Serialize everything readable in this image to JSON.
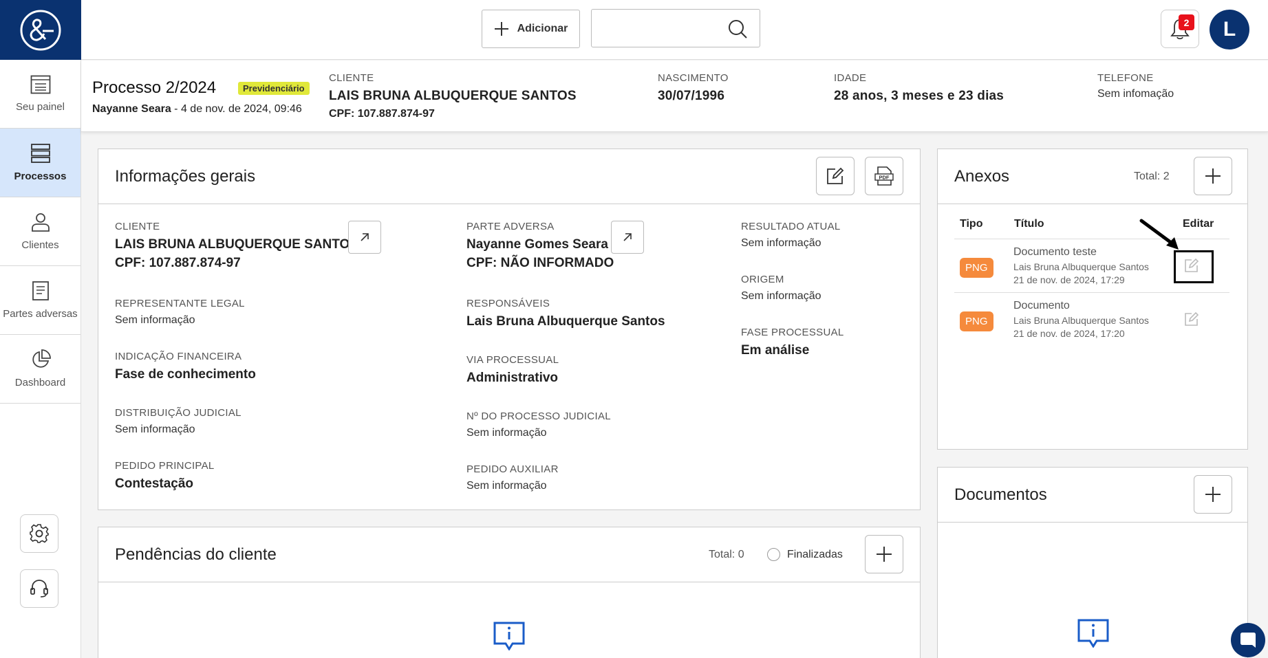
{
  "sidebar": {
    "items": [
      {
        "label": "Seu painel",
        "icon": "dashboard-list-icon"
      },
      {
        "label": "Processos",
        "icon": "stack-icon"
      },
      {
        "label": "Clientes",
        "icon": "person-icon"
      },
      {
        "label": "Partes adversas",
        "icon": "document-icon"
      },
      {
        "label": "Dashboard",
        "icon": "pie-chart-icon"
      }
    ]
  },
  "topbar": {
    "add_label": "Adicionar",
    "search_value": "",
    "search_placeholder": "",
    "notifications_count": "2",
    "avatar_initial": "L"
  },
  "process": {
    "title": "Processo 2/2024",
    "badge": "Previdenciário",
    "author": "Nayanne Seara",
    "date": " - 4 de nov. de 2024, 09:46",
    "cliente_label": "CLIENTE",
    "cliente_name": "LAIS BRUNA ALBUQUERQUE SANTOS",
    "cliente_cpf": "CPF: 107.887.874-97",
    "nascimento_label": "NASCIMENTO",
    "nascimento_value": "30/07/1996",
    "idade_label": "IDADE",
    "idade_value": "28 anos, 3 meses e 23 dias",
    "telefone_label": "TELEFONE",
    "telefone_value": "Sem infomação"
  },
  "info": {
    "title": "Informações gerais",
    "cliente_label": "CLIENTE",
    "cliente_name": "LAIS BRUNA ALBUQUERQUE SANTOS",
    "cliente_cpf": "CPF: 107.887.874-97",
    "representante_label": "REPRESENTANTE LEGAL",
    "representante_value": "Sem informação",
    "indicacao_label": "INDICAÇÃO FINANCEIRA",
    "indicacao_value": "Fase de conhecimento",
    "distribuicao_label": "DISTRIBUIÇÃO JUDICIAL",
    "distribuicao_value": "Sem informação",
    "pedido_principal_label": "PEDIDO PRINCIPAL",
    "pedido_principal_value": "Contestação",
    "parte_label": "PARTE ADVERSA",
    "parte_name": "Nayanne Gomes Seara",
    "parte_cpf": "CPF: NÃO INFORMADO",
    "responsaveis_label": "RESPONSÁVEIS",
    "responsaveis_value": "Lais Bruna Albuquerque Santos",
    "via_label": "VIA PROCESSUAL",
    "via_value": "Administrativo",
    "num_label": "Nº DO PROCESSO JUDICIAL",
    "num_value": "Sem informação",
    "pedido_aux_label": "PEDIDO AUXILIAR",
    "pedido_aux_value": "Sem informação",
    "resultado_label": "RESULTADO ATUAL",
    "resultado_value": "Sem informação",
    "origem_label": "ORIGEM",
    "origem_value": "Sem informação",
    "fase_label": "FASE PROCESSUAL",
    "fase_value": "Em análise"
  },
  "pendencias": {
    "title": "Pendências do cliente",
    "total": "Total: 0",
    "finalizadas_label": "Finalizadas"
  },
  "anexos": {
    "title": "Anexos",
    "total": "Total: 2",
    "col_tipo": "Tipo",
    "col_titulo": "Título",
    "col_editar": "Editar",
    "rows": [
      {
        "tipo": "PNG",
        "titulo": "Documento teste",
        "autor": "Lais Bruna Albuquerque Santos",
        "data": "21 de nov. de 2024, 17:29"
      },
      {
        "tipo": "PNG",
        "titulo": "Documento",
        "autor": "Lais Bruna Albuquerque Santos",
        "data": "21 de nov. de 2024, 17:20"
      }
    ]
  },
  "documentos": {
    "title": "Documentos"
  },
  "colors": {
    "brand": "#0a3270",
    "active_nav": "#d6e6fb",
    "badge": "#e0e83a",
    "png_tag": "#f58a3c",
    "notification": "#e8111b"
  }
}
